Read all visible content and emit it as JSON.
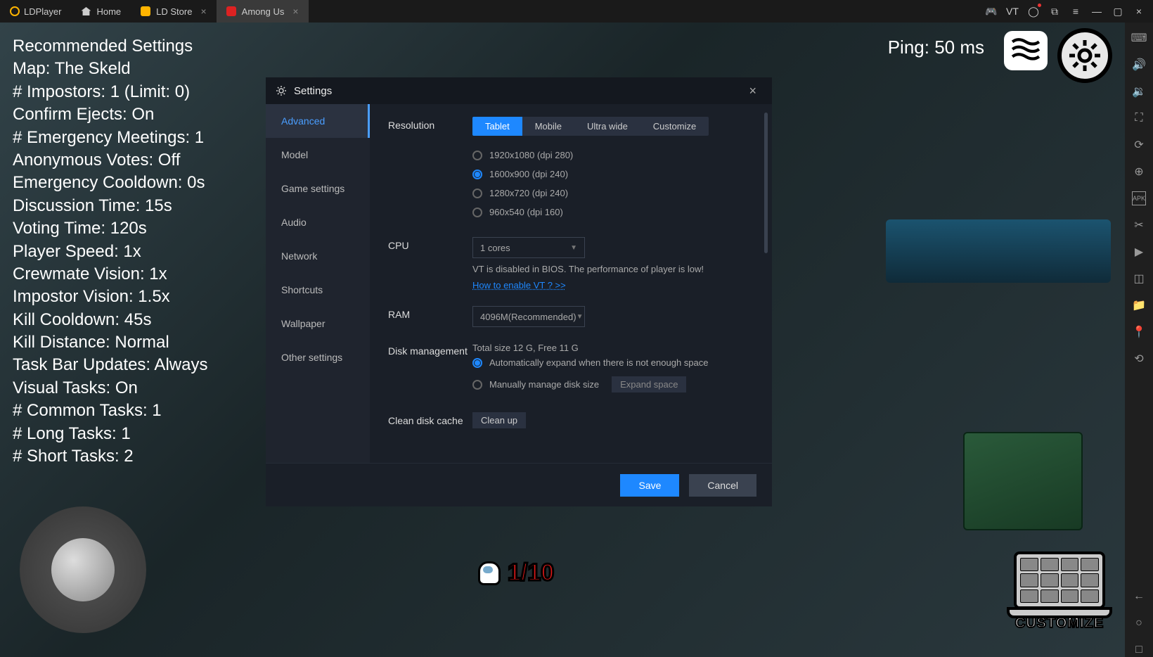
{
  "topbar": {
    "brand": "LDPlayer",
    "tabs": [
      {
        "label": "Home",
        "closable": false
      },
      {
        "label": "LD Store",
        "closable": true
      },
      {
        "label": "Among Us",
        "closable": true,
        "active": true
      }
    ],
    "vt_label": "VT"
  },
  "game": {
    "settings_text": [
      "Recommended Settings",
      "Map: The Skeld",
      "# Impostors: 1 (Limit: 0)",
      "Confirm Ejects: On",
      "# Emergency Meetings: 1",
      "Anonymous Votes: Off",
      "Emergency Cooldown: 0s",
      "Discussion Time: 15s",
      "Voting Time: 120s",
      "Player Speed: 1x",
      "Crewmate Vision: 1x",
      "Impostor Vision: 1.5x",
      "Kill Cooldown: 45s",
      "Kill Distance: Normal",
      "Task Bar Updates: Always",
      "Visual Tasks: On",
      "# Common Tasks: 1",
      "# Long Tasks: 1",
      "# Short Tasks: 2"
    ],
    "ping": "Ping: 50 ms",
    "player_count": "1/10",
    "customize": "CUSTOMIZE"
  },
  "modal": {
    "title": "Settings",
    "sidebar": [
      "Advanced",
      "Model",
      "Game settings",
      "Audio",
      "Network",
      "Shortcuts",
      "Wallpaper",
      "Other settings"
    ],
    "resolution": {
      "label": "Resolution",
      "tabs": [
        "Tablet",
        "Mobile",
        "Ultra wide",
        "Customize"
      ],
      "options": [
        "1920x1080  (dpi 280)",
        "1600x900  (dpi 240)",
        "1280x720  (dpi 240)",
        "960x540  (dpi 160)"
      ],
      "selected_index": 1
    },
    "cpu": {
      "label": "CPU",
      "value": "1 cores",
      "warning": "VT is disabled in BIOS. The performance of player is low!",
      "link": "How to enable VT ? >>"
    },
    "ram": {
      "label": "RAM",
      "value": "4096M(Recommended)"
    },
    "disk": {
      "label": "Disk management",
      "info": "Total size 12 G,  Free 11 G",
      "auto": "Automatically expand when there is not enough space",
      "manual": "Manually manage disk size",
      "expand": "Expand space"
    },
    "clean": {
      "label": "Clean disk cache",
      "button": "Clean up"
    },
    "save": "Save",
    "cancel": "Cancel"
  }
}
